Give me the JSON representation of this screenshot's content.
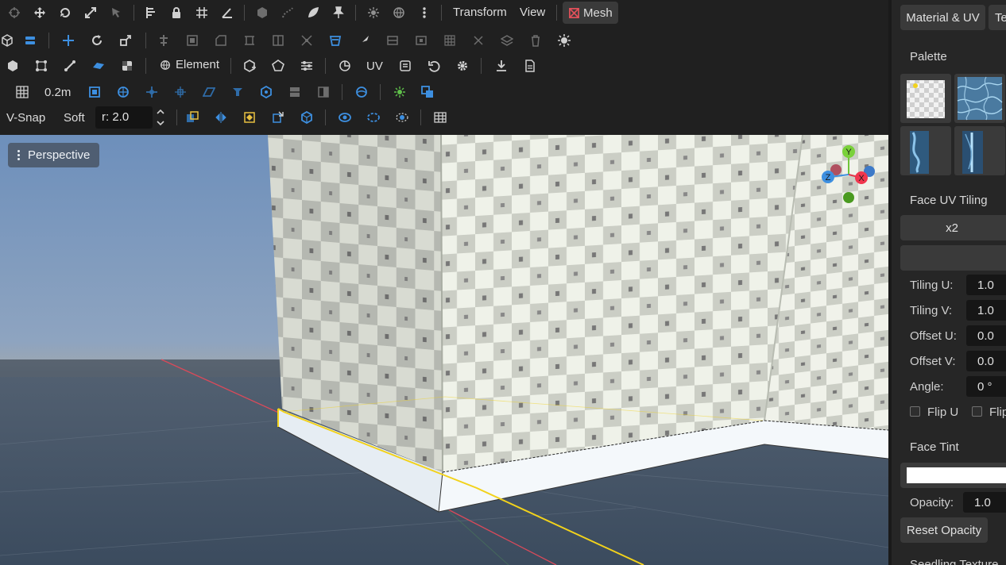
{
  "toolbar": {
    "transform_label": "Transform",
    "view_label": "View",
    "mesh_label": "Mesh",
    "element_label": "Element",
    "uv_label": "UV",
    "grid_size": "0.2m",
    "vsnap_label": "V-Snap",
    "soft_label": "Soft",
    "radius_value": "r: 2.0"
  },
  "viewport": {
    "mode_label": "Perspective",
    "gizmo": {
      "y": "Y",
      "z": "Z",
      "x": "X"
    }
  },
  "panel": {
    "tab_material": "Material & UV",
    "tab_texture": "Te",
    "palette_title": "Palette",
    "face_uv_tiling_title": "Face UV Tiling",
    "tiling_button": "x2",
    "fields": {
      "tiling_u_label": "Tiling U:",
      "tiling_u_value": "1.0",
      "tiling_v_label": "Tiling V:",
      "tiling_v_value": "1.0",
      "offset_u_label": "Offset U:",
      "offset_u_value": "0.0",
      "offset_v_label": "Offset V:",
      "offset_v_value": "0.0",
      "angle_label": "Angle:",
      "angle_value": "0 °"
    },
    "flip_u_label": "Flip U",
    "flip_v_label": "Flip",
    "face_tint_title": "Face Tint",
    "tint_color": "#ffffff",
    "opacity_label": "Opacity:",
    "opacity_value": "1.0",
    "reset_opacity_label": "Reset Opacity",
    "bottom_cut_label": "Seedling Texture"
  },
  "colors": {
    "accent_blue": "#3d8fe0",
    "mesh_red": "#e0505a",
    "selection_yellow": "#f2d21b"
  }
}
